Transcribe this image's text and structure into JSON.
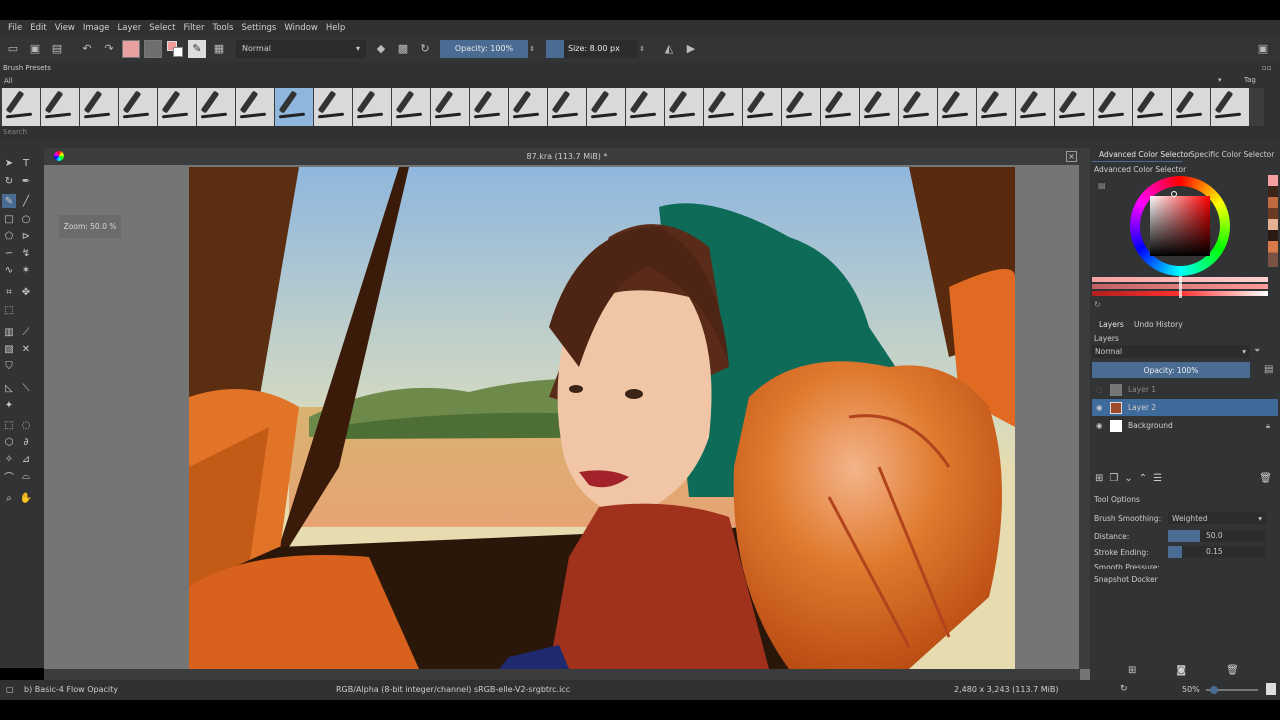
{
  "menu": [
    "File",
    "Edit",
    "View",
    "Image",
    "Layer",
    "Select",
    "Filter",
    "Tools",
    "Settings",
    "Window",
    "Help"
  ],
  "toolbar": {
    "blend_mode": "Normal",
    "opacity_label": "Opacity: 100%",
    "size_label": "Size: 8.00 px"
  },
  "presets": {
    "title": "Brush Presets",
    "filter_value": "All",
    "tag_label": "Tag",
    "search_placeholder": "Search"
  },
  "document": {
    "title": "87.kra (113.7 MiB) *",
    "zoom_tooltip": "Zoom: 50.0 %"
  },
  "color_selector": {
    "tab_advanced": "Advanced Color Selector",
    "tab_specific": "Specific Color Selector",
    "header": "Advanced Color Selector"
  },
  "layers_panel": {
    "tab_layers": "Layers",
    "tab_undo": "Undo History",
    "header": "Layers",
    "blend_mode": "Normal",
    "opacity_label": "Opacity: 100%",
    "layers": [
      {
        "name": "Layer 1",
        "visible": false,
        "selected": false
      },
      {
        "name": "Layer 2",
        "visible": true,
        "selected": true
      },
      {
        "name": "Background",
        "visible": true,
        "selected": false
      }
    ]
  },
  "tool_options": {
    "header": "Tool Options",
    "smoothing_label": "Brush Smoothing:",
    "smoothing_value": "Weighted",
    "distance_label": "Distance:",
    "distance_value": "50.0",
    "stroke_ending_label": "Stroke Ending:",
    "stroke_ending_value": "0.15",
    "smooth_pressure_label": "Smooth Pressure:"
  },
  "snapshot_docker": "Snapshot Docker",
  "status": {
    "brush": "b) Basic-4 Flow Opacity",
    "color_space": "RGB/Alpha (8-bit integer/channel)  sRGB-elle-V2-srgbtrc.icc",
    "dimensions": "2,480 x 3,243 (113.7 MiB)",
    "zoom": "50%"
  },
  "colors": {
    "accent": "#4a6c93",
    "selected_layer": "#3f6a9c",
    "current_fg": "#f29a9a",
    "sky": "#a9c6df",
    "orange_seat": "#d9651c",
    "teal_scarf": "#0e6b58"
  }
}
